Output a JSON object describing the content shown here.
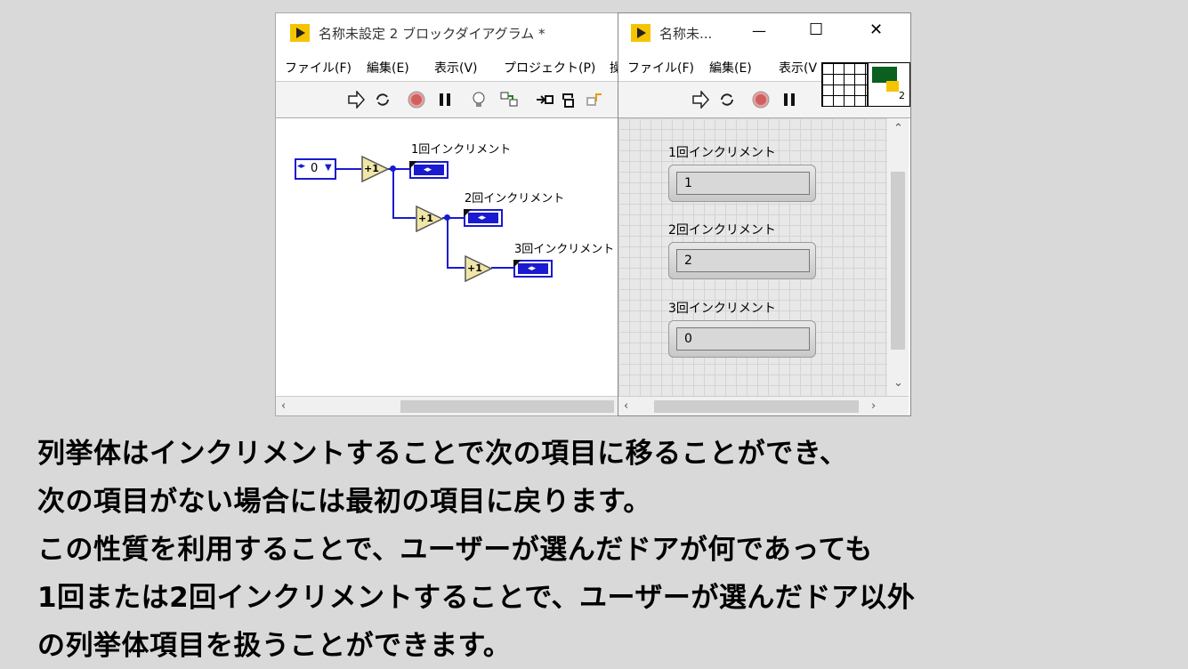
{
  "block_diagram": {
    "title": "名称未設定 2 ブロックダイアグラム *",
    "menu": [
      "ファイル(F)",
      "編集(E)",
      "表示(V)",
      "プロジェクト(P)",
      "操"
    ],
    "constant_value": "0",
    "increment_symbol": "+1",
    "labels": [
      "1回インクリメント",
      "2回インクリメント",
      "3回インクリメント"
    ]
  },
  "front_panel": {
    "title": "名称未...",
    "window_controls": [
      "—",
      "☐",
      "✕"
    ],
    "menu": [
      "ファイル(F)",
      "編集(E)",
      "表示(V"
    ],
    "indicators": [
      {
        "label": "1回インクリメント",
        "value": "1"
      },
      {
        "label": "2回インクリメント",
        "value": "2"
      },
      {
        "label": "3回インクリメント",
        "value": "0"
      }
    ],
    "connector_count": "2"
  },
  "caption": [
    "列挙体はインクリメントすることで次の項目に移ることができ、",
    "次の項目がない場合には最初の項目に戻ります。",
    "この性質を利用することで、ユーザーが選んだドアが何であっても",
    "1回または2回インクリメントすることで、ユーザーが選んだドア以外",
    "の列挙体項目を扱うことができます。"
  ]
}
